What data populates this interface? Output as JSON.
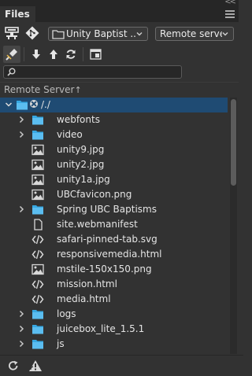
{
  "panel": {
    "tab_title": "Files",
    "collapse_glyph": "<<"
  },
  "toolbar": {
    "site_select_value": "Unity Baptist ...",
    "server_select_value": "Remote server"
  },
  "search": {
    "placeholder": ""
  },
  "column": {
    "header_label": "Remote Server",
    "sort_arrow": "↑"
  },
  "tree": {
    "root_label": "/./",
    "items": [
      {
        "name": "webfonts",
        "type": "folder"
      },
      {
        "name": "video",
        "type": "folder"
      },
      {
        "name": "unity9.jpg",
        "type": "image"
      },
      {
        "name": "unity2.jpg",
        "type": "image"
      },
      {
        "name": "unity1a.jpg",
        "type": "image"
      },
      {
        "name": "UBCfavicon.png",
        "type": "image"
      },
      {
        "name": "Spring UBC Baptisms",
        "type": "folder"
      },
      {
        "name": "site.webmanifest",
        "type": "file"
      },
      {
        "name": "safari-pinned-tab.svg",
        "type": "code"
      },
      {
        "name": "responsivemedia.html",
        "type": "code"
      },
      {
        "name": "mstile-150x150.png",
        "type": "image"
      },
      {
        "name": "mission.html",
        "type": "code"
      },
      {
        "name": "media.html",
        "type": "code"
      },
      {
        "name": "logs",
        "type": "folder"
      },
      {
        "name": "juicebox_lite_1.5.1",
        "type": "folder"
      },
      {
        "name": "js",
        "type": "folder"
      }
    ]
  },
  "colors": {
    "panel_bg": "#323232",
    "selection": "#1f4b73",
    "folder": "#37a8e2"
  }
}
